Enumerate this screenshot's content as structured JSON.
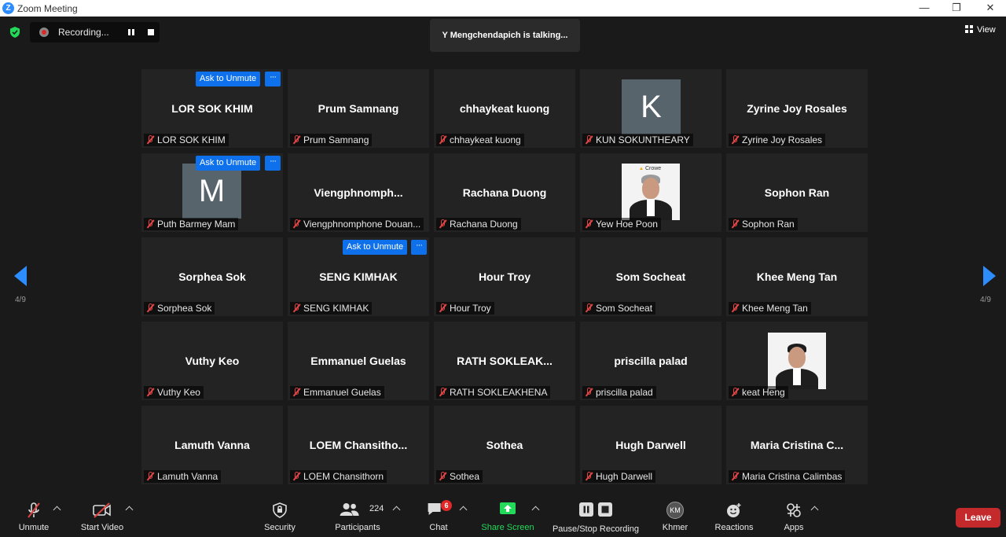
{
  "window": {
    "title": "Zoom Meeting"
  },
  "top": {
    "recording_label": "Recording...",
    "talking": "Y Mengchendapich is talking...",
    "view_label": "View"
  },
  "pager": {
    "left": "4/9",
    "right": "4/9"
  },
  "ask_label": "Ask to Unmute",
  "more_label": "···",
  "participants": [
    {
      "center": "LOR SOK KHIM",
      "label": "LOR SOK KHIM",
      "ask": true
    },
    {
      "center": "Prum Samnang",
      "label": "Prum Samnang"
    },
    {
      "center": "chhaykeat kuong",
      "label": "chhaykeat kuong"
    },
    {
      "center": "",
      "avatar": "K",
      "label": "KUN SOKUNTHEARY"
    },
    {
      "center": "Zyrine Joy Rosales",
      "label": "Zyrine Joy Rosales"
    },
    {
      "center": "",
      "avatar": "M",
      "label": "Puth Barmey Mam",
      "ask": true
    },
    {
      "center": "Viengphnomph...",
      "label": "Viengphnomphone Douan..."
    },
    {
      "center": "Rachana Duong",
      "label": "Rachana Duong"
    },
    {
      "center": "",
      "photo": "Crowe",
      "label": "Yew Hoe Poon"
    },
    {
      "center": "Sophon Ran",
      "label": "Sophon Ran"
    },
    {
      "center": "Sorphea Sok",
      "label": "Sorphea Sok"
    },
    {
      "center": "SENG KIMHAK",
      "label": "SENG KIMHAK",
      "ask": true
    },
    {
      "center": "Hour Troy",
      "label": "Hour Troy"
    },
    {
      "center": "Som Socheat",
      "label": "Som Socheat"
    },
    {
      "center": "Khee Meng Tan",
      "label": "Khee Meng Tan"
    },
    {
      "center": "Vuthy Keo",
      "label": "Vuthy Keo"
    },
    {
      "center": "Emmanuel Guelas",
      "label": "Emmanuel Guelas"
    },
    {
      "center": "RATH  SOKLEAK...",
      "label": "RATH SOKLEAKHENA"
    },
    {
      "center": "priscilla palad",
      "label": "priscilla palad"
    },
    {
      "center": "",
      "photo": "",
      "label": "keat Heng"
    },
    {
      "center": "Lamuth Vanna",
      "label": "Lamuth Vanna"
    },
    {
      "center": "LOEM  Chansitho...",
      "label": "LOEM Chansithorn"
    },
    {
      "center": "Sothea",
      "label": "Sothea"
    },
    {
      "center": "Hugh Darwell",
      "label": "Hugh Darwell"
    },
    {
      "center": "Maria  Cristina  C...",
      "label": "Maria Cristina Calimbas"
    }
  ],
  "toolbar": {
    "unmute": "Unmute",
    "start_video": "Start Video",
    "security": "Security",
    "participants": "Participants",
    "participants_count": "224",
    "chat": "Chat",
    "chat_badge": "6",
    "share_screen": "Share Screen",
    "pause_stop": "Pause/Stop Recording",
    "khmer": "Khmer",
    "khmer_initials": "KM",
    "reactions": "Reactions",
    "apps": "Apps",
    "leave": "Leave"
  },
  "colors": {
    "accent": "#2d8cff",
    "share_green": "#23d959",
    "leave_red": "#c4292c",
    "ask_blue": "#0e71eb"
  }
}
